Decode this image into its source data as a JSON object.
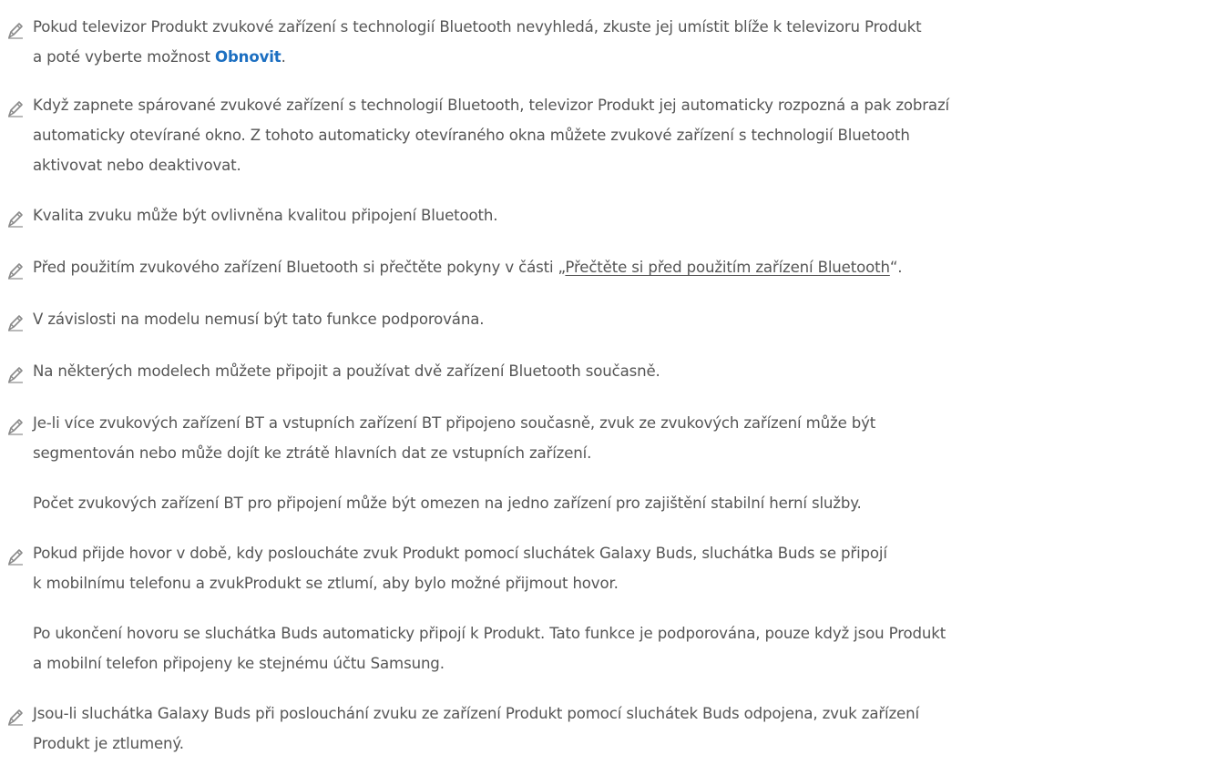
{
  "notes": [
    {
      "lines": [
        "Pokud televizor Produkt zvukové zařízení s technologií Bluetooth nevyhledá, zkuste jej umístit blíže k televizoru Produkt",
        "a poté vyberte možnost"
      ],
      "link_text": "Obnovit",
      "after_link": "."
    },
    {
      "lines": [
        "Když zapnete spárované zvukové zařízení s technologií Bluetooth, televizor Produkt jej automaticky rozpozná a pak zobrazí",
        "automaticky otevírané okno. Z tohoto automaticky otevíraného okna můžete zvukové zařízení s technologií Bluetooth",
        "aktivovat nebo deaktivovat."
      ]
    },
    {
      "lines": [
        "Kvalita zvuku může být ovlivněna kvalitou připojení Bluetooth."
      ]
    },
    {
      "before_ref": "Před použitím zvukového zařízení Bluetooth si přečtěte pokyny v části „",
      "ref_text": "Přečtěte si před použitím zařízení Bluetooth",
      "after_ref": "“."
    },
    {
      "lines": [
        "V závislosti na modelu nemusí být tato funkce podporována."
      ]
    },
    {
      "lines": [
        "Na některých modelech můžete připojit a používat dvě zařízení Bluetooth současně."
      ]
    },
    {
      "lines": [
        "Je-li více zvukových zařízení BT a vstupních zařízení BT připojeno současně, zvuk ze zvukových zařízení může být",
        "segmentován nebo může dojít ke ztrátě hlavních dat ze vstupních zařízení."
      ],
      "extra": [
        "Počet zvukových zařízení BT pro připojení může být omezen na jedno zařízení pro zajištění stabilní herní služby."
      ]
    },
    {
      "lines": [
        "Pokud přijde hovor v době, kdy posloucháte zvuk Produkt pomocí sluchátek Galaxy Buds, sluchátka Buds se připojí",
        "k mobilnímu telefonu a zvukProdukt se ztlumí, aby bylo možné přijmout hovor."
      ],
      "extra": [
        "Po ukončení hovoru se sluchátka Buds automaticky připojí k Produkt. Tato funkce je podporována, pouze když jsou Produkt",
        "a mobilní telefon připojeny ke stejnému účtu Samsung."
      ]
    },
    {
      "lines": [
        "Jsou-li sluchátka Galaxy Buds při poslouchání zvuku ze zařízení Produkt pomocí sluchátek Buds odpojena, zvuk zařízení",
        "Produkt je ztlumený."
      ]
    }
  ],
  "icon": "pencil-icon",
  "colors": {
    "text": "#555555",
    "link": "#1c6fc1",
    "icon": "#8a8a8a"
  }
}
